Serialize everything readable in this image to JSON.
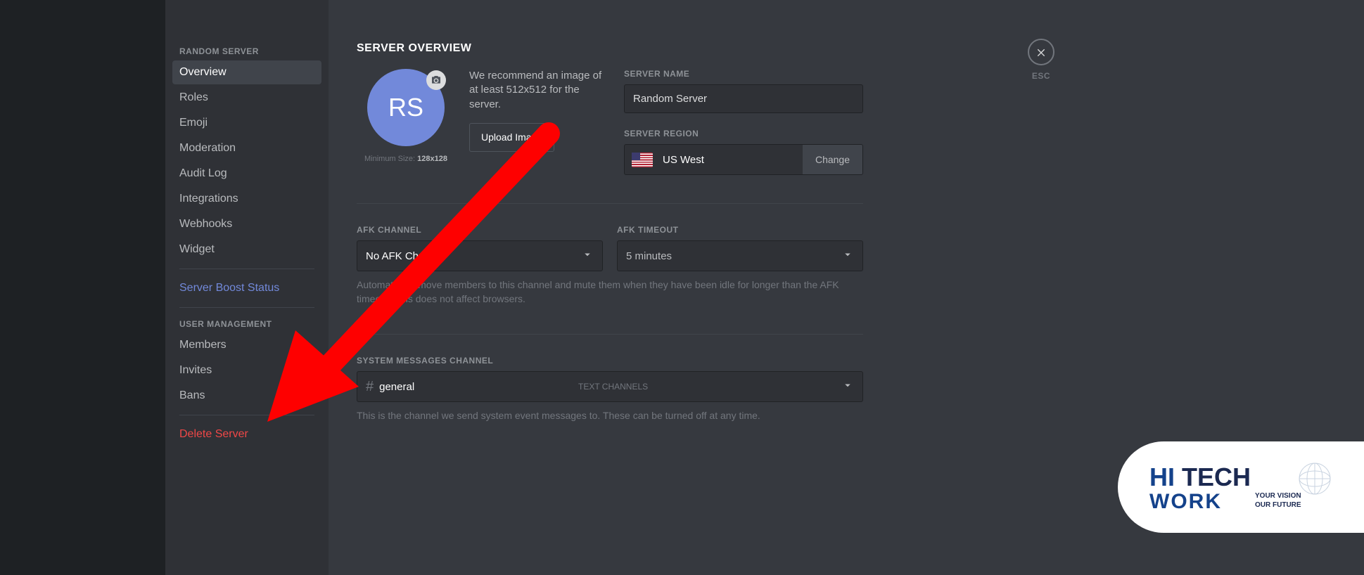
{
  "sidebar": {
    "header1": "RANDOM SERVER",
    "items1": [
      {
        "label": "Overview",
        "selected": true
      },
      {
        "label": "Roles"
      },
      {
        "label": "Emoji"
      },
      {
        "label": "Moderation"
      },
      {
        "label": "Audit Log"
      },
      {
        "label": "Integrations"
      },
      {
        "label": "Webhooks"
      },
      {
        "label": "Widget"
      }
    ],
    "boost": "Server Boost Status",
    "header2": "USER MANAGEMENT",
    "items2": [
      {
        "label": "Members"
      },
      {
        "label": "Invites"
      },
      {
        "label": "Bans"
      }
    ],
    "delete": "Delete Server"
  },
  "page": {
    "title": "SERVER OVERVIEW",
    "avatar_initials": "RS",
    "min_size_prefix": "Minimum Size: ",
    "min_size_value": "128x128",
    "recommend_text": "We recommend an image of at least 512x512 for the server.",
    "upload_label": "Upload Image"
  },
  "server_name": {
    "label": "SERVER NAME",
    "value": "Random Server"
  },
  "server_region": {
    "label": "SERVER REGION",
    "value": "US West",
    "change": "Change"
  },
  "afk_channel": {
    "label": "AFK CHANNEL",
    "value": "No AFK Channel"
  },
  "afk_timeout": {
    "label": "AFK TIMEOUT",
    "value": "5 minutes"
  },
  "afk_help": "Automatically move members to this channel and mute them when they have been idle for longer than the AFK timeout. This does not affect browsers.",
  "system_channel": {
    "label": "SYSTEM MESSAGES CHANNEL",
    "value": "general",
    "suffix": "TEXT CHANNELS"
  },
  "system_help": "This is the channel we send system event messages to. These can be turned off at any time.",
  "close": {
    "esc": "ESC"
  },
  "watermark": {
    "line1a": "HI",
    "line1b": "TECH",
    "line2": "WORK",
    "tag1": "YOUR VISION",
    "tag2": "OUR FUTURE"
  }
}
